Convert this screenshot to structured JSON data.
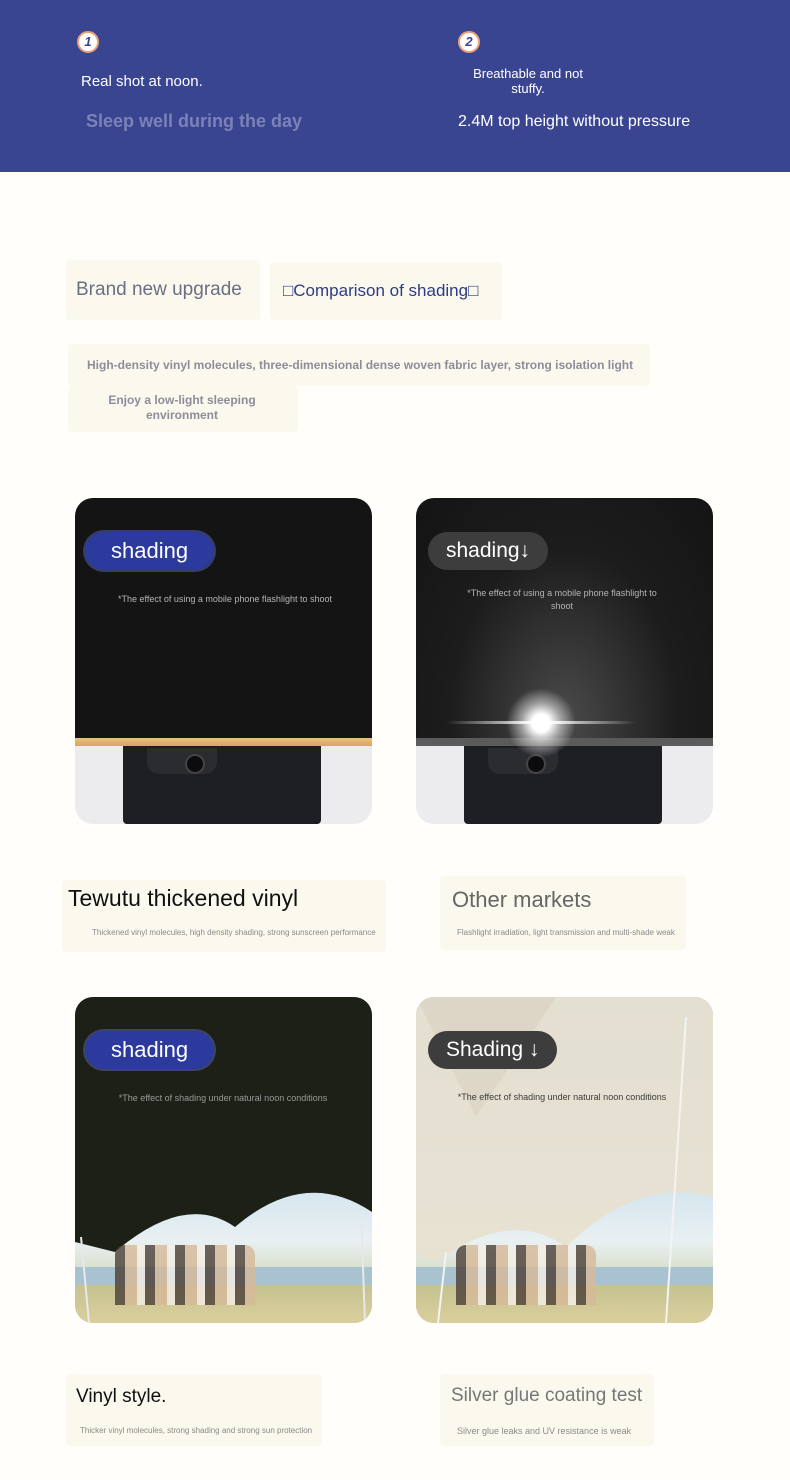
{
  "header": {
    "badge1": "1",
    "badge2": "2",
    "col1_line1": "Real shot at noon.",
    "col1_line2": "Sleep well during the day",
    "col2_line1a": "Breathable and not",
    "col2_line1b": "stuffy.",
    "col2_line2": "2.4M top height without pressure"
  },
  "intro": {
    "title_left": "Brand new upgrade",
    "title_right": "□Comparison of shading□",
    "desc1": "High-density vinyl molecules, three-dimensional dense woven fabric layer, strong isolation light",
    "desc2a": "Enjoy a low-light sleeping",
    "desc2b": "environment"
  },
  "flashlight_row": {
    "left_pill": "shading",
    "left_caption": "*The effect of using a mobile phone flashlight to shoot",
    "right_pill": "shading↓",
    "right_caption_a": "*The effect of using a mobile phone flashlight to",
    "right_caption_b": "shoot"
  },
  "labels_row1": {
    "left_title": "Tewutu thickened vinyl",
    "left_desc": "Thickened vinyl molecules, high density shading, strong sunscreen performance",
    "right_title": "Other markets",
    "right_desc": "Flashlight irradiation, light transmission and multi-shade weak"
  },
  "sun_row": {
    "left_pill": "shading",
    "left_caption": "*The effect of shading under natural noon conditions",
    "right_pill": "Shading ↓",
    "right_caption": "*The effect of shading under natural noon conditions"
  },
  "labels_row2": {
    "left_title": "Vinyl style.",
    "left_desc": "Thicker vinyl molecules, strong shading and strong sun protection",
    "right_title": "Silver glue coating test",
    "right_desc": "Silver glue leaks and UV resistance is weak"
  },
  "colors": {
    "banner": "#3a4591",
    "accent_blue": "#2b3a9c",
    "badge_ring": "#e8a27a"
  }
}
